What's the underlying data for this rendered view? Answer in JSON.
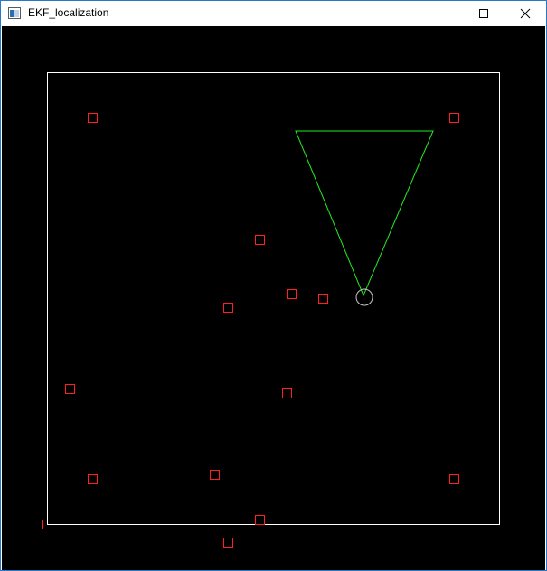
{
  "window": {
    "title": "EKF_localization",
    "controls": {
      "minimize_icon": "minimize-icon",
      "maximize_icon": "maximize-icon",
      "close_icon": "close-icon"
    }
  },
  "scene": {
    "colors": {
      "background": "#000000",
      "boundary": "#ffffff",
      "landmark": "#ff2020",
      "sensor_fov": "#22ee22",
      "robot": "#c8c8c8"
    },
    "landmark_count": 14,
    "landmark_icon": "landmark-square-icon",
    "robot_icon": "robot-circle-icon",
    "sensor_icon": "sensor-fov-triangle-icon"
  }
}
